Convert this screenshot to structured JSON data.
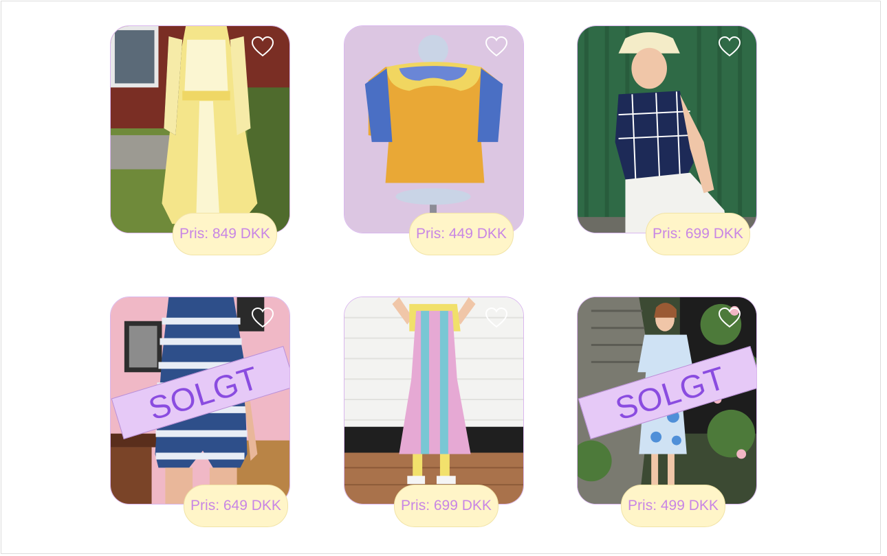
{
  "products": [
    {
      "price": "Pris: 849 DKK",
      "sold": false,
      "image": "yellow-striped-dress-photo"
    },
    {
      "price": "Pris: 449 DKK",
      "sold": false,
      "image": "mustard-top-with-collar-photo"
    },
    {
      "price": "Pris: 699 DKK",
      "sold": false,
      "image": "navy-check-shirt-photo"
    },
    {
      "price": "Pris: 649 DKK",
      "sold": true,
      "image": "blue-striped-romper-photo"
    },
    {
      "price": "Pris: 699 DKK",
      "sold": false,
      "image": "pink-blue-striped-dress-photo"
    },
    {
      "price": "Pris: 499 DKK",
      "sold": true,
      "image": "blue-floral-dress-photo"
    }
  ],
  "sold_label": "SOLGT",
  "icons": {
    "favorite": "heart-outline-icon"
  },
  "colors": {
    "price_bg": "#fff5c8",
    "price_text": "#c886e4",
    "sold_bg": "#e6c9f7",
    "sold_text": "#8a4ce0",
    "card_border": "#d9b6ee"
  }
}
